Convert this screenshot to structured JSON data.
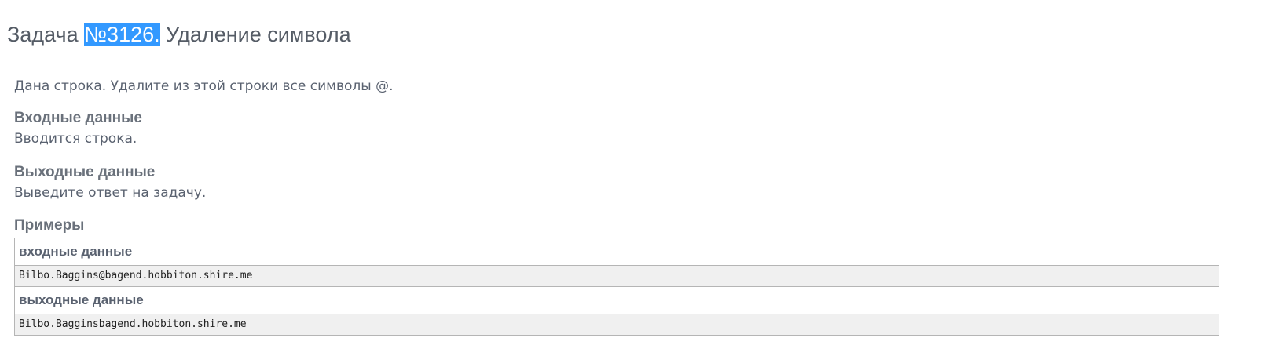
{
  "problem": {
    "title_prefix": "Задача ",
    "title_number": "№3126.",
    "title_name": " Удаление символа",
    "statement": "Дана строка. Удалите из этой строки все символы @.",
    "input_heading": "Входные данные",
    "input_text": "Вводится строка.",
    "output_heading": "Выходные данные",
    "output_text": "Выведите ответ на задачу.",
    "examples_heading": "Примеры"
  },
  "examples": {
    "input_label": "входные данные",
    "input_value": "Bilbo.Baggins@bagend.hobbiton.shire.me",
    "output_label": "выходные данные",
    "output_value": "Bilbo.Bagginsbagend.hobbiton.shire.me"
  },
  "colors": {
    "selection_highlight": "#3399ff",
    "example_row_bg": "#f0f0f0",
    "border": "#b5b5b5"
  }
}
